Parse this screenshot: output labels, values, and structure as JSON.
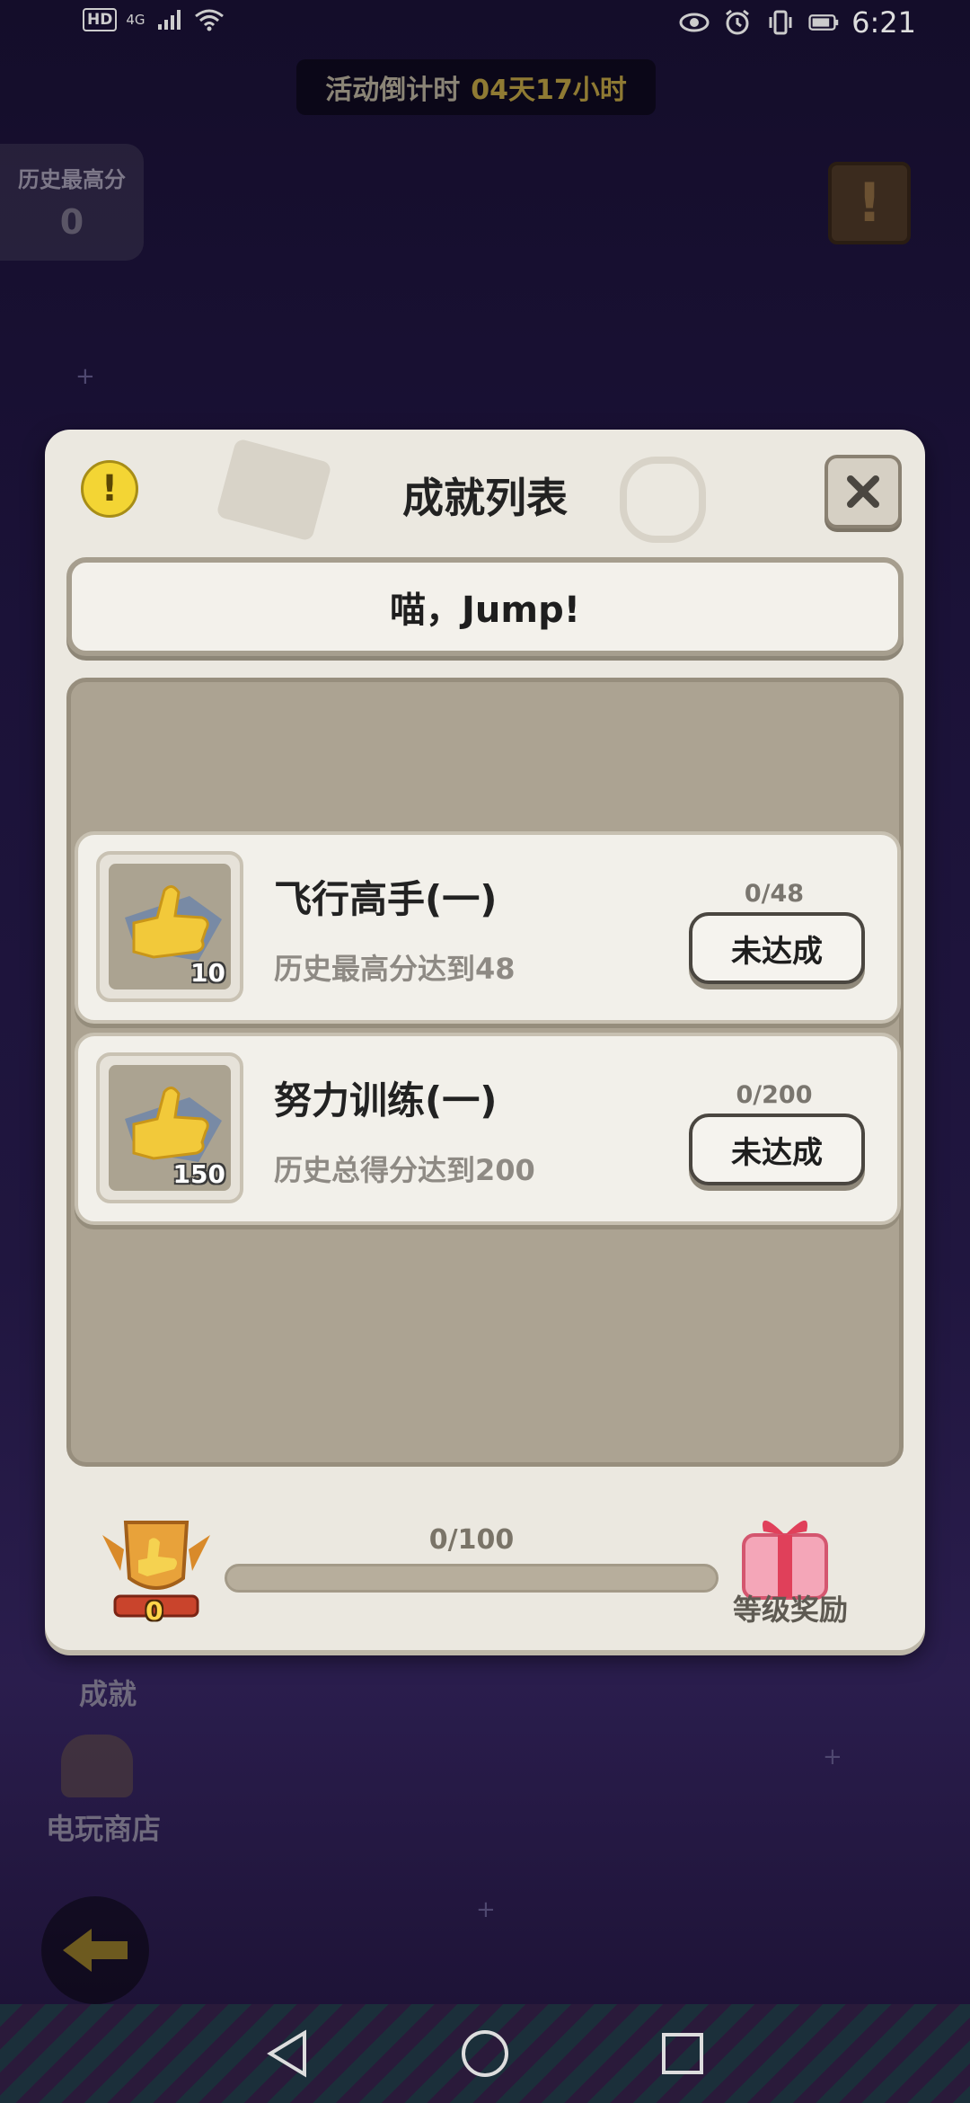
{
  "status_bar": {
    "hd": "HD",
    "network": "4G",
    "time": "6:21"
  },
  "background": {
    "countdown_label": "活动倒计时",
    "countdown_value": "04天17小时",
    "hiscore_label": "历史最高分",
    "hiscore_value": "0",
    "achievements_label": "成就",
    "shop_label": "电玩商店"
  },
  "modal": {
    "title": "成就列表",
    "category_tab": "喵，Jump!",
    "achievements": [
      {
        "name": "飞行高手(一)",
        "description": "历史最高分达到48",
        "progress": "0/48",
        "status": "未达成",
        "reward_count": "10"
      },
      {
        "name": "努力训练(一)",
        "description": "历史总得分达到200",
        "progress": "0/200",
        "status": "未达成",
        "reward_count": "150"
      }
    ],
    "footer": {
      "trophy_count": "0",
      "level_progress": "0/100",
      "level_progress_fraction": 0,
      "level_reward_label": "等级奖励"
    }
  },
  "colors": {
    "modal_bg": "#ebe8e0",
    "panel_bg": "#aca392",
    "info_yellow": "#f3d534",
    "countdown_value": "#8f7a33"
  }
}
